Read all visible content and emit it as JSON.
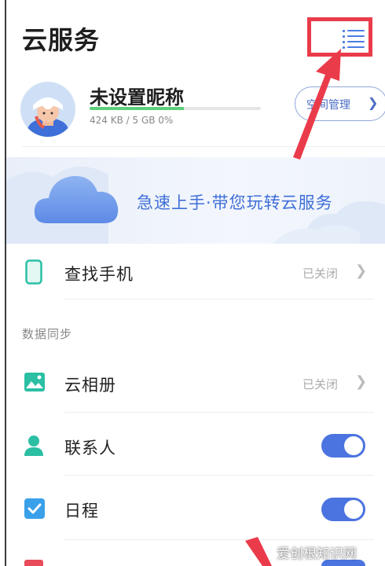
{
  "header": {
    "title": "云服务",
    "menu_icon": "list-menu-icon"
  },
  "profile": {
    "nickname": "未设置昵称",
    "storage_text": "424 KB / 5 GB 0%",
    "storage_used_percent": 0,
    "space_button_label": "空间管理"
  },
  "banner": {
    "text": "急速上手·带您玩转云服务"
  },
  "find_phone": {
    "label": "查找手机",
    "status": "已关闭"
  },
  "sync_section": {
    "title": "数据同步",
    "items": [
      {
        "label": "云相册",
        "status": "已关闭",
        "icon": "gallery-icon"
      },
      {
        "label": "联系人",
        "toggle_on": true,
        "icon": "contact-icon"
      },
      {
        "label": "日程",
        "toggle_on": true,
        "icon": "calendar-check-icon"
      },
      {
        "label": "",
        "toggle_on": true,
        "icon": "red-square-icon"
      }
    ]
  },
  "watermark": {
    "text": "爱创根知识网"
  },
  "colors": {
    "accent": "#4b74e0",
    "highlight": "#ea3b4a",
    "teal": "#2bbfa4"
  }
}
